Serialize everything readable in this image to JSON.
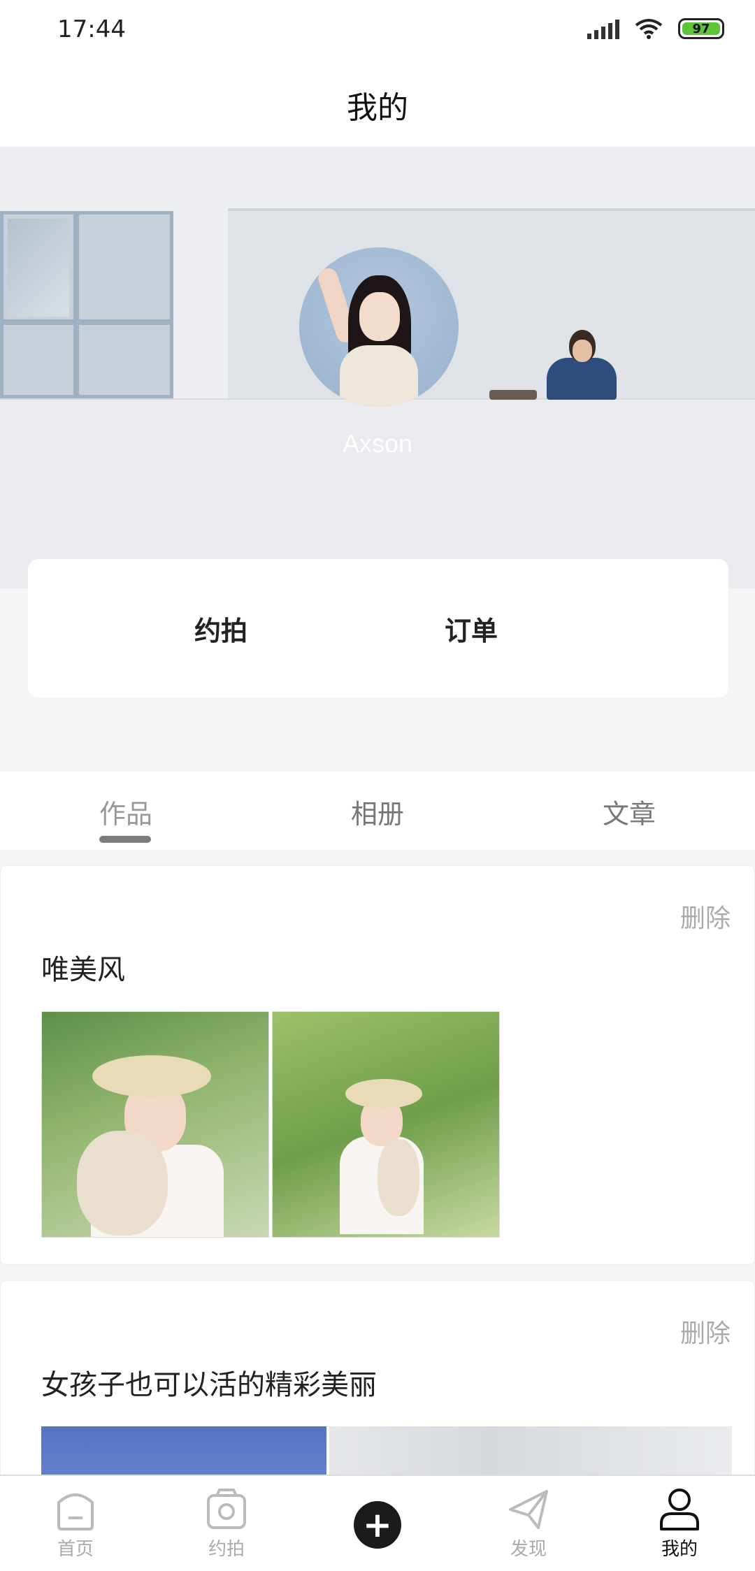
{
  "status_bar": {
    "time": "17:44",
    "battery": "97"
  },
  "header": {
    "title": "我的"
  },
  "profile": {
    "username": "Axson"
  },
  "actions": {
    "yuepai": "约拍",
    "order": "订单"
  },
  "tabs": [
    {
      "label": "作品",
      "active": true
    },
    {
      "label": "相册",
      "active": false
    },
    {
      "label": "文章",
      "active": false
    }
  ],
  "posts": [
    {
      "title": "唯美风",
      "delete_label": "删除"
    },
    {
      "title": "女孩子也可以活的精彩美丽",
      "delete_label": "删除"
    }
  ],
  "bottom_nav": [
    {
      "label": "首页",
      "icon": "home-icon"
    },
    {
      "label": "约拍",
      "icon": "camera-icon"
    },
    {
      "label": "",
      "icon": "add-icon"
    },
    {
      "label": "发现",
      "icon": "paper-plane-icon"
    },
    {
      "label": "我的",
      "icon": "user-icon",
      "active": true
    }
  ],
  "colors": {
    "accent": "#1b1b1b",
    "battery": "#5ec43a",
    "muted": "#aaaaaa"
  }
}
